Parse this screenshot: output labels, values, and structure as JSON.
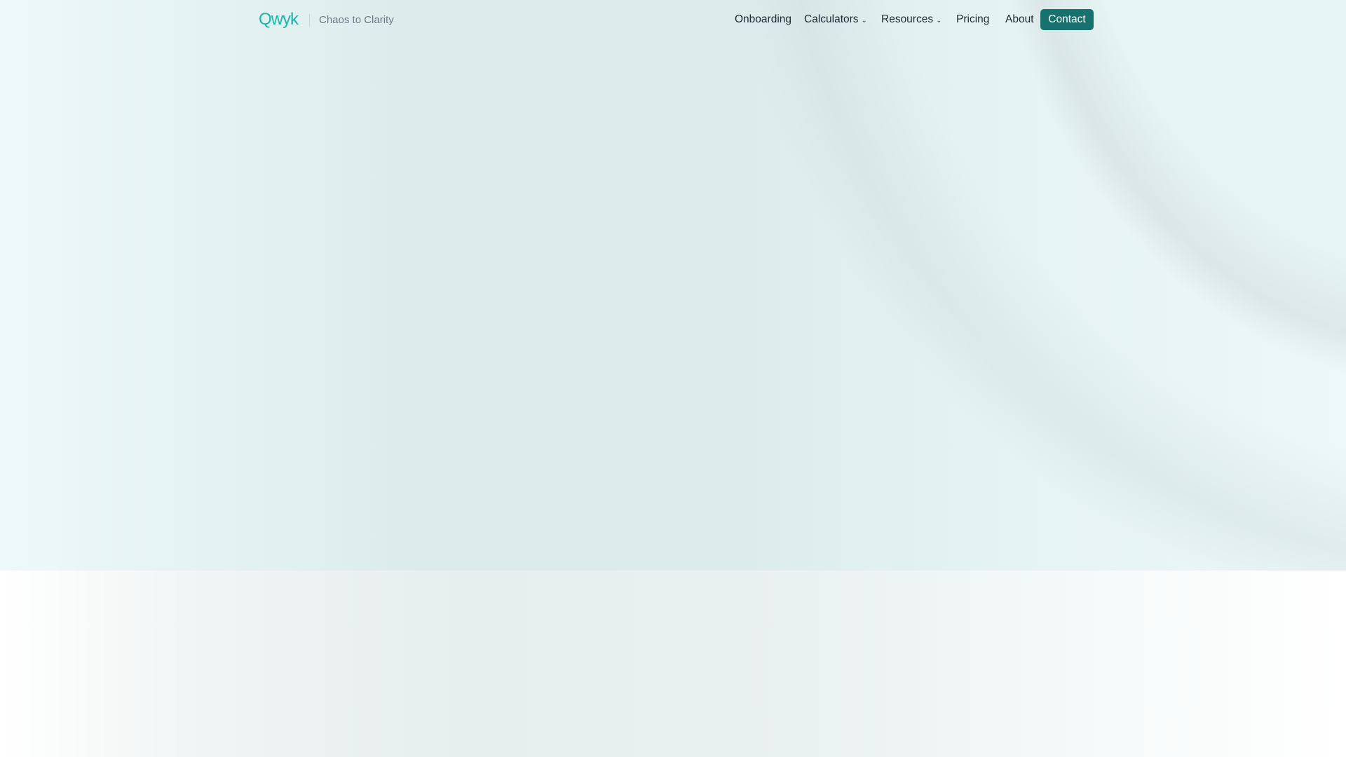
{
  "header": {
    "logo": "Qwyk",
    "tagline": "Chaos to Clarity",
    "nav": [
      {
        "label": "Onboarding"
      },
      {
        "label": "Calculators",
        "has_dropdown": true
      },
      {
        "label": "Resources",
        "has_dropdown": true
      },
      {
        "label": "Pricing"
      },
      {
        "label": "About"
      }
    ],
    "contact_label": "Contact",
    "chevron": "⌄"
  },
  "colors": {
    "brand": "#1fb5a8",
    "button": "#17716f"
  }
}
